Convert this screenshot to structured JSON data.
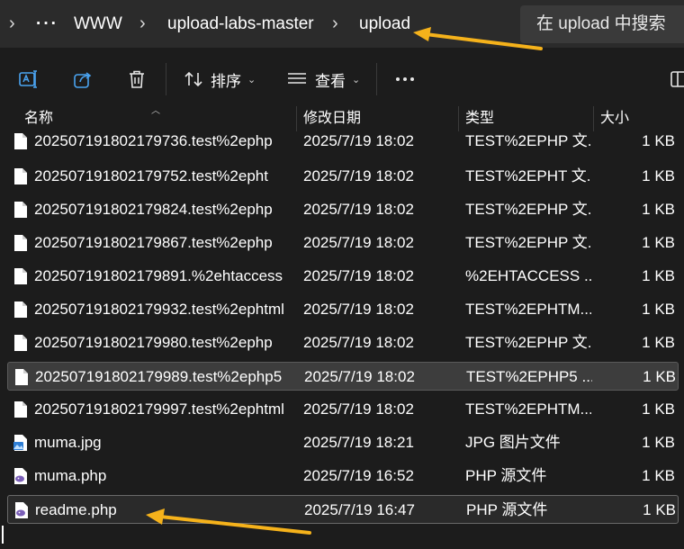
{
  "breadcrumb": {
    "items": [
      "WWW",
      "upload-labs-master",
      "upload"
    ]
  },
  "search": {
    "placeholder": "在 upload 中搜索"
  },
  "toolbar": {
    "sort_label": "排序",
    "view_label": "查看"
  },
  "columns": {
    "name": "名称",
    "date": "修改日期",
    "type": "类型",
    "size": "大小"
  },
  "files": [
    {
      "name": "202507191802179736.test%2ephp",
      "date": "2025/7/19 18:02",
      "type": "TEST%2EPHP 文...",
      "size": "1 KB",
      "icon": "file-icon"
    },
    {
      "name": "202507191802179752.test%2epht",
      "date": "2025/7/19 18:02",
      "type": "TEST%2EPHT 文...",
      "size": "1 KB",
      "icon": "file-icon"
    },
    {
      "name": "202507191802179824.test%2ephp",
      "date": "2025/7/19 18:02",
      "type": "TEST%2EPHP 文...",
      "size": "1 KB",
      "icon": "file-icon"
    },
    {
      "name": "202507191802179867.test%2ephp",
      "date": "2025/7/19 18:02",
      "type": "TEST%2EPHP 文...",
      "size": "1 KB",
      "icon": "file-icon"
    },
    {
      "name": "202507191802179891.%2ehtaccess",
      "date": "2025/7/19 18:02",
      "type": "%2EHTACCESS ...",
      "size": "1 KB",
      "icon": "file-icon"
    },
    {
      "name": "202507191802179932.test%2ephtml",
      "date": "2025/7/19 18:02",
      "type": "TEST%2EPHTM...",
      "size": "1 KB",
      "icon": "file-icon"
    },
    {
      "name": "202507191802179980.test%2ephp",
      "date": "2025/7/19 18:02",
      "type": "TEST%2EPHP 文...",
      "size": "1 KB",
      "icon": "file-icon"
    },
    {
      "name": "202507191802179989.test%2ephp5",
      "date": "2025/7/19 18:02",
      "type": "TEST%2EPHP5 ...",
      "size": "1 KB",
      "icon": "file-icon"
    },
    {
      "name": "202507191802179997.test%2ephtml",
      "date": "2025/7/19 18:02",
      "type": "TEST%2EPHTM...",
      "size": "1 KB",
      "icon": "file-icon"
    },
    {
      "name": "muma.jpg",
      "date": "2025/7/19 18:21",
      "type": "JPG 图片文件",
      "size": "1 KB",
      "icon": "image-file-icon"
    },
    {
      "name": "muma.php",
      "date": "2025/7/19 16:52",
      "type": "PHP 源文件",
      "size": "1 KB",
      "icon": "php-file-icon"
    },
    {
      "name": "readme.php",
      "date": "2025/7/19 16:47",
      "type": "PHP 源文件",
      "size": "1 KB",
      "icon": "php-file-icon"
    }
  ],
  "colors": {
    "background": "#1c1c1c",
    "annotation_arrow": "#f5b21b",
    "selected_row": "#3d3d3d"
  }
}
